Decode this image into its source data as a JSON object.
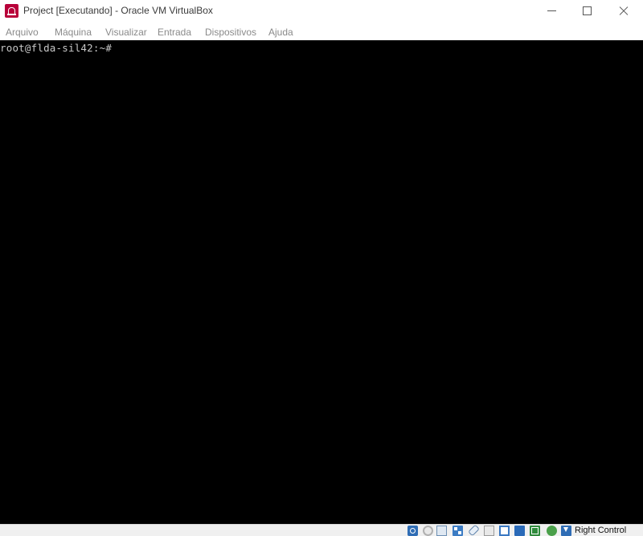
{
  "window": {
    "title": "Project [Executando] - Oracle VM VirtualBox",
    "app_icon": "virtualbox-icon"
  },
  "titlebar_controls": {
    "minimize_icon": "minimize-icon",
    "maximize_icon": "maximize-icon",
    "close_icon": "close-icon"
  },
  "menubar": {
    "items": [
      {
        "label": "Arquivo"
      },
      {
        "label": "Máquina"
      },
      {
        "label": "Visualizar"
      },
      {
        "label": "Entrada"
      },
      {
        "label": "Dispositivos"
      },
      {
        "label": "Ajuda"
      }
    ]
  },
  "console": {
    "prompt": "root@flda-sil42:~#"
  },
  "statusbar": {
    "icons": [
      "hard-disk-icon",
      "optical-drive-icon",
      "audio-icon",
      "network-icon",
      "usb-icon",
      "shared-folders-icon",
      "display-icon",
      "video-capture-icon",
      "virtualization-icon",
      "mouse-integration-icon",
      "keyboard-icon"
    ],
    "host_key": "Right Control"
  },
  "colors": {
    "console_bg": "#000000",
    "console_text": "#c8c8c8",
    "menu_text": "#8a8a8a",
    "icon_brand": "#b8003a"
  }
}
